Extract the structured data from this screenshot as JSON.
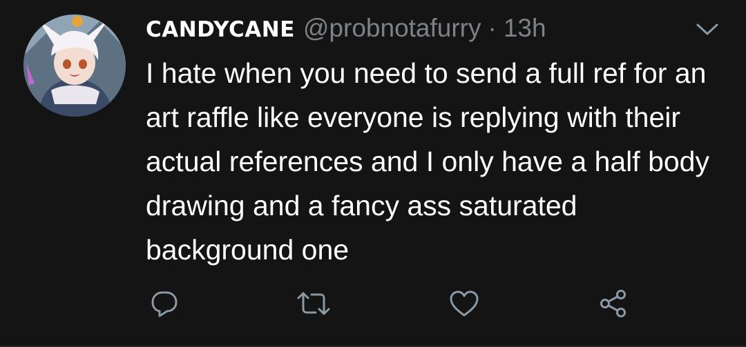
{
  "tweet": {
    "display_name": "CANDYCANE",
    "handle": "@probnotafurry",
    "separator": "·",
    "time": "13h",
    "body": "I hate when you need to send a full ref for an art raffle like everyone is replying with their actual references and I only have a half body drawing and a fancy ass saturated background one"
  },
  "icons": {
    "menu": "chevron-down-icon",
    "reply": "reply-icon",
    "retweet": "retweet-icon",
    "like": "heart-icon",
    "share": "share-icon"
  },
  "colors": {
    "background": "#141414",
    "text": "#ffffff",
    "muted": "#7e8287",
    "icon": "#8b98a5"
  }
}
